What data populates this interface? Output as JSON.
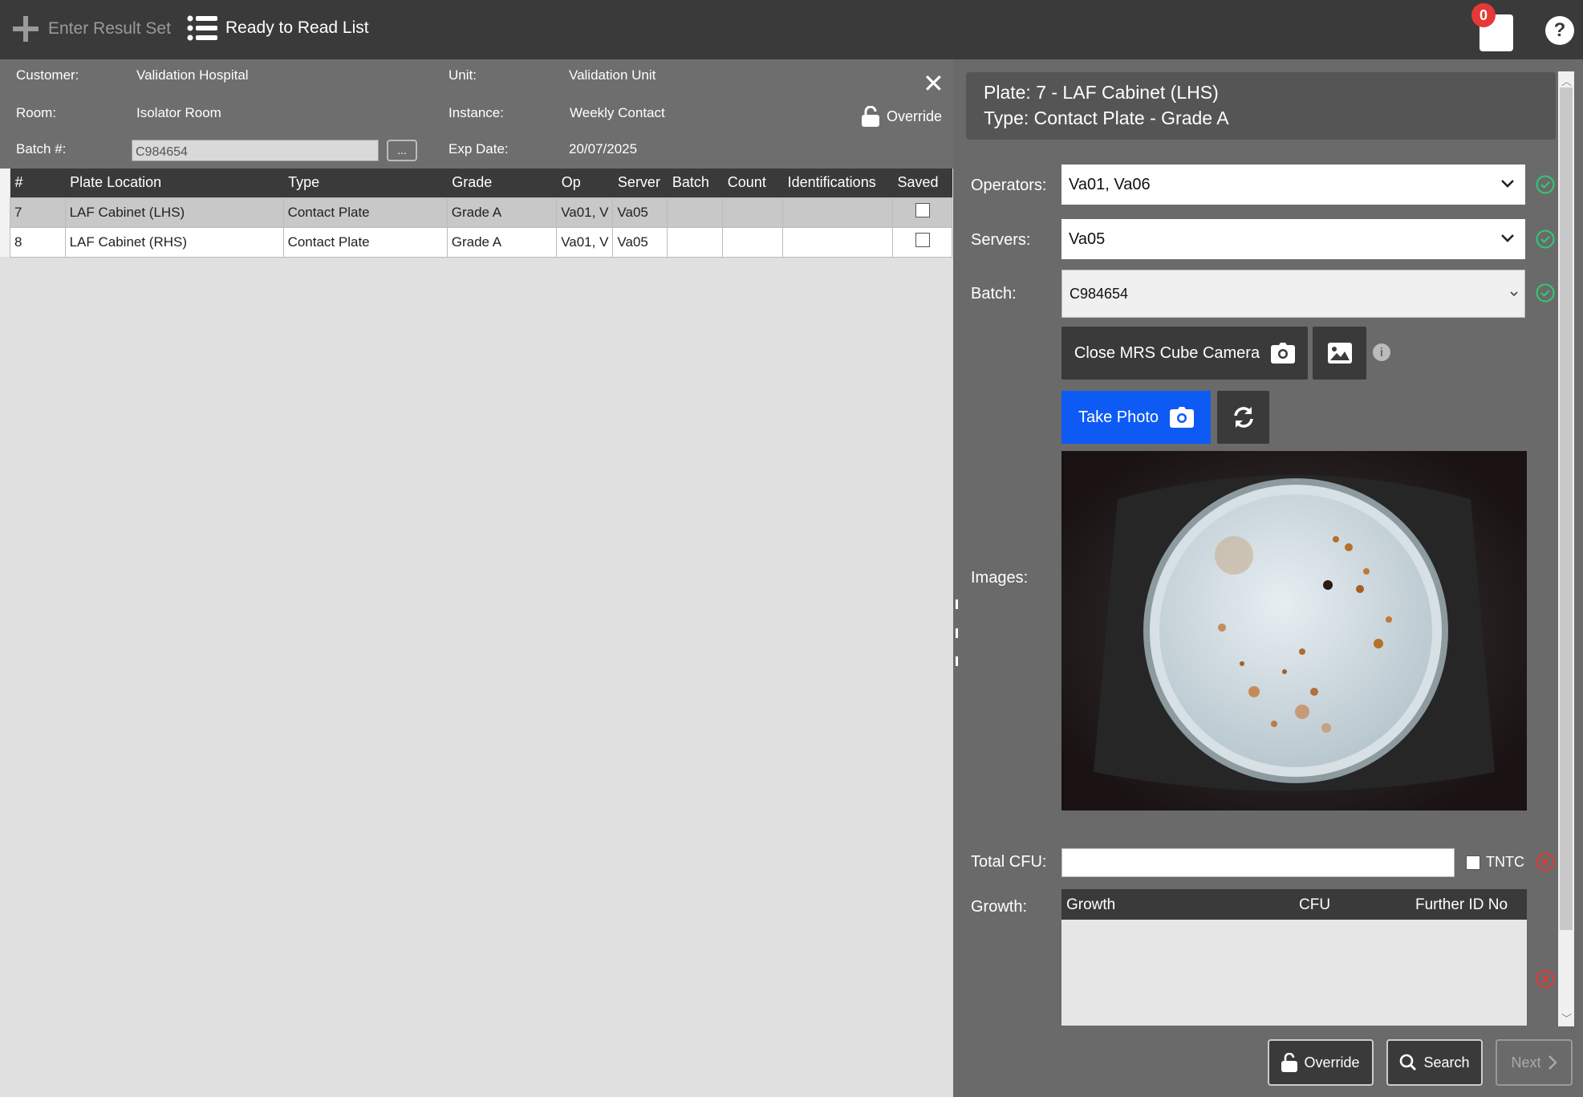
{
  "topbar": {
    "enter_result_set": "Enter Result Set",
    "ready_to_read_list": "Ready to Read List",
    "notification_count": "0",
    "help": "?"
  },
  "info": {
    "customer_label": "Customer:",
    "customer": "Validation Hospital",
    "unit_label": "Unit:",
    "unit": "Validation Unit",
    "room_label": "Room:",
    "room": "Isolator Room",
    "instance_label": "Instance:",
    "instance": "Weekly Contact",
    "batch_label": "Batch #:",
    "batch_value": "C984654",
    "batch_button": "...",
    "exp_label": "Exp Date:",
    "exp_date": "20/07/2025",
    "override": "Override"
  },
  "table": {
    "headers": [
      "#",
      "Plate Location",
      "Type",
      "Grade",
      "Op",
      "Server",
      "Batch",
      "Count",
      "Identifications",
      "Saved"
    ],
    "rows": [
      {
        "num": "7",
        "location": "LAF Cabinet (LHS)",
        "type": "Contact Plate",
        "grade": "Grade A",
        "op": "Va01, V",
        "server": "Va05",
        "batch": "",
        "count": "",
        "ids": "",
        "saved": false
      },
      {
        "num": "8",
        "location": "LAF Cabinet (RHS)",
        "type": "Contact Plate",
        "grade": "Grade A",
        "op": "Va01, V",
        "server": "Va05",
        "batch": "",
        "count": "",
        "ids": "",
        "saved": false
      }
    ]
  },
  "detail": {
    "plate_line": "Plate:  7  -  LAF Cabinet (LHS)",
    "type_line": "Type:  Contact Plate  -  Grade A",
    "operators_label": "Operators:",
    "operators": "Va01, Va06",
    "servers_label": "Servers:",
    "servers": "Va05",
    "batch_label": "Batch:",
    "batch": "C984654",
    "close_camera": "Close MRS Cube Camera",
    "take_photo": "Take Photo",
    "images_label": "Images:",
    "total_cfu_label": "Total CFU:",
    "total_cfu": "",
    "tntc": "TNTC",
    "growth_label": "Growth:",
    "growth_headers": {
      "growth": "Growth",
      "cfu": "CFU",
      "further": "Further ID No"
    }
  },
  "footer": {
    "override": "Override",
    "search": "Search",
    "next": "Next"
  },
  "colors": {
    "topbar": "#3a3a3a",
    "panel": "#6a6a6a",
    "accent_blue": "#0d5af5",
    "ok_green": "#2ecc71",
    "error_red": "#e53935"
  }
}
